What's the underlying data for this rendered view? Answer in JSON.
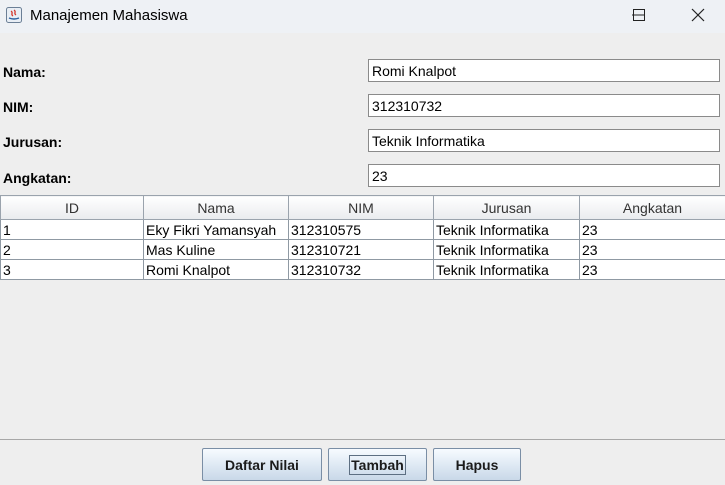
{
  "window": {
    "title": "Manajemen Mahasiswa",
    "icons": [
      "java-app-icon",
      "minimize-icon",
      "maximize-icon",
      "close-icon"
    ]
  },
  "form": {
    "nama": {
      "label": "Nama:",
      "value": "Romi Knalpot"
    },
    "nim": {
      "label": "NIM:",
      "value": "312310732"
    },
    "jurusan": {
      "label": "Jurusan:",
      "value": "Teknik Informatika"
    },
    "angkatan": {
      "label": "Angkatan:",
      "value": "23"
    }
  },
  "table": {
    "columns": [
      "ID",
      "Nama",
      "NIM",
      "Jurusan",
      "Angkatan"
    ],
    "rows": [
      [
        "1",
        "Eky Fikri Yamansyah",
        "312310575",
        "Teknik Informatika",
        "23"
      ],
      [
        "2",
        "Mas Kuline",
        "312310721",
        "Teknik Informatika",
        "23"
      ],
      [
        "3",
        "Romi Knalpot",
        "312310732",
        "Teknik Informatika",
        "23"
      ]
    ]
  },
  "buttons": {
    "daftar_nilai": "Daftar Nilai",
    "tambah": "Tambah",
    "hapus": "Hapus"
  },
  "colors": {
    "window_bg": "#eeeeee",
    "titlebar_bg": "#eef1f5",
    "button_top": "#f7fbff",
    "button_bottom": "#c9d8e8",
    "grid_border": "#8f99a3"
  }
}
